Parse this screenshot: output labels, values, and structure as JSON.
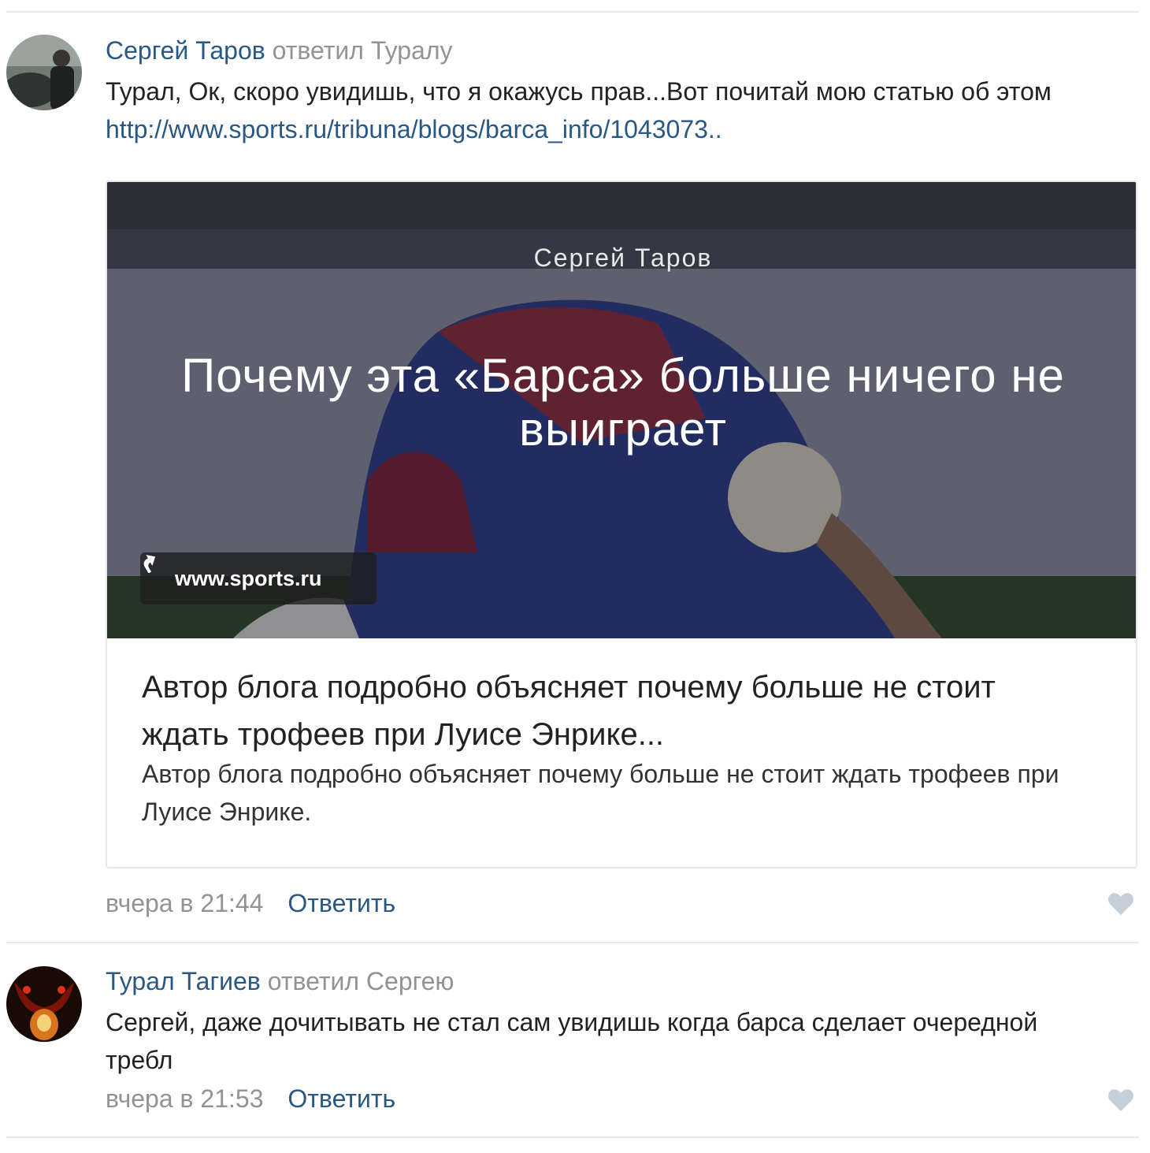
{
  "comments": [
    {
      "author": "Сергей Таров",
      "replied_text": "ответил Туралу",
      "text": "Турал, Ок, скоро увидишь, что я окажусь прав...Вот почитай мою статью об этом",
      "link": "http://www.sports.ru/tribuna/blogs/barca_info/1043073..",
      "date": "вчера в 21:44",
      "reply_label": "Ответить",
      "avatar_icon": "user-photo-icon",
      "like_icon": "heart-icon",
      "attachment": {
        "author": "Сергей Таров",
        "title": "Почему эта «Барса» больше ничего не выиграет",
        "source": "www.sports.ru",
        "source_icon": "external-link-arrow-icon",
        "heading": "Автор блога подробно объясняет почему больше не стоит ждать трофеев при Луисе Энрике...",
        "description": "Автор блога подробно объясняет почему больше не стоит ждать трофеев при Луисе Энрике."
      }
    },
    {
      "author": "Турал Тагиев",
      "replied_text": "ответил Сергею",
      "text": "Сергей, даже дочитывать не стал сам увидишь когда барса сделает очередной требл",
      "date": "вчера в 21:53",
      "reply_label": "Ответить",
      "avatar_icon": "user-photo-icon",
      "like_icon": "heart-icon"
    }
  ],
  "colors": {
    "link": "#2a5885",
    "muted": "#939393",
    "divider": "#e7e8ec",
    "heart": "#c5d0db"
  }
}
